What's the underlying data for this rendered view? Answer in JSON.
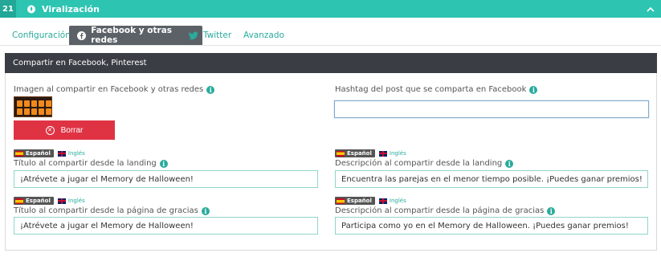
{
  "section": {
    "number": "21",
    "title": "Viralización",
    "icon": "fire-icon",
    "collapse_icon": "chevron-up-icon"
  },
  "tabs": [
    {
      "label": "Configuración",
      "active": false
    },
    {
      "label": "Facebook y otras redes",
      "active": true,
      "icon": "facebook-icon"
    },
    {
      "label": "Twitter",
      "active": false,
      "icon": "twitter-icon"
    },
    {
      "label": "Avanzado",
      "active": false
    }
  ],
  "panel": {
    "title": "Compartir en Facebook, Pinterest"
  },
  "image_share": {
    "label": "Imagen al compartir en Facebook y otras redes",
    "delete_label": "Borrar"
  },
  "hashtag": {
    "label": "Hashtag del post que se comparta en Facebook",
    "value": ""
  },
  "languages": {
    "spanish": "Español",
    "english": "Inglés"
  },
  "title_landing": {
    "label": "Título al compartir desde la landing",
    "value": "¡Atrévete a jugar el Memory de Halloween!"
  },
  "desc_landing": {
    "label": "Descripción al compartir desde la landing",
    "value": "Encuentra las parejas en el menor tiempo posible. ¡Puedes ganar premios!"
  },
  "title_thanks": {
    "label": "Título al compartir desde la página de gracias",
    "value": "¡Atrévete a jugar el Memory de Halloween!"
  },
  "desc_thanks": {
    "label": "Descripción al compartir desde la página de gracias",
    "value": "Participa como yo en el Memory de Halloween. ¡Puedes ganar premios!"
  },
  "colors": {
    "accent": "#2ec4b2",
    "header_dark": "#3a3d44",
    "delete": "#df3344"
  }
}
